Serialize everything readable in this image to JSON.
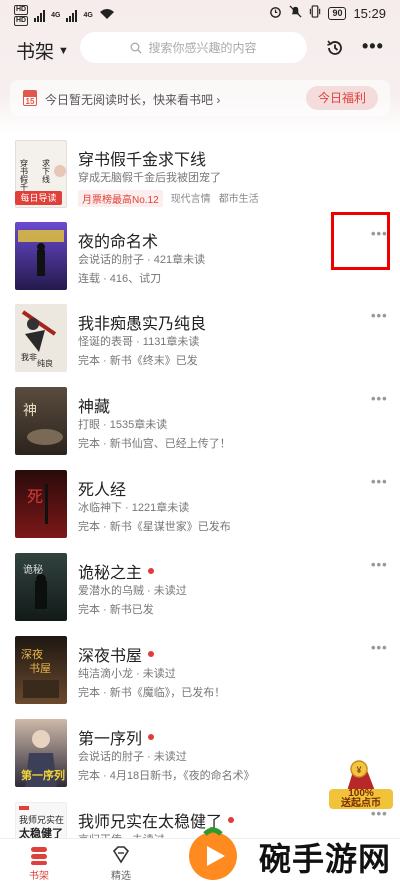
{
  "status_bar": {
    "sim1": "HD",
    "sim2": "HD",
    "net1": "4G",
    "net2": "4G",
    "battery": "90",
    "time": "15:29"
  },
  "header": {
    "title": "书架",
    "search_placeholder": "搜索你感兴趣的内容"
  },
  "banner": {
    "calendar_day": "15",
    "text": "今日暂无阅读时长，快来看书吧",
    "arrow": "›",
    "button": "今日福利"
  },
  "featured": {
    "title": "穿书假千金求下线",
    "subtitle": "穿成无脑假千金后我被团宠了",
    "badge": "每日导读",
    "tags": [
      "月票榜最高No.12",
      "现代言情",
      "都市生活"
    ],
    "cover_text": "穿书假千金求下线"
  },
  "books": [
    {
      "title": "夜的命名术",
      "line1": "会说话的肘子 · 421章未读",
      "line2": "连载 · 416、试刀",
      "dot": false,
      "cover_text": "夜的命名术",
      "cover_color": "#3a2a6e"
    },
    {
      "title": "我非痴愚实乃纯良",
      "line1": "怪诞的表哥 · 1131章未读",
      "line2": "完本 · 新书《终末》已发",
      "dot": false,
      "cover_text": "我非痴愚 实乃纯良",
      "cover_color": "#e9e4dd"
    },
    {
      "title": "神藏",
      "line1": "打眼 · 1535章未读",
      "line2": "完本 · 新书仙宫、已经上传了！",
      "dot": false,
      "cover_text": "神藏",
      "cover_color": "#4b4034"
    },
    {
      "title": "死人经",
      "line1": "冰临神下 · 1221章未读",
      "line2": "完本 · 新书《星谋世家》已发布",
      "dot": false,
      "cover_text": "死人经",
      "cover_color": "#5a1212"
    },
    {
      "title": "诡秘之主",
      "line1": "爱潜水的乌贼 · 未读过",
      "line2": "完本 · 新书已发",
      "dot": true,
      "cover_text": "诡秘之主",
      "cover_color": "#2a3a38"
    },
    {
      "title": "深夜书屋",
      "line1": "纯洁滴小龙 · 未读过",
      "line2": "完本 · 新书《魔临》，已发布！",
      "dot": true,
      "cover_text": "深夜书屋",
      "cover_color": "#3b2a1e"
    },
    {
      "title": "第一序列",
      "line1": "会说话的肘子 · 未读过",
      "line2": "完本 · 4月18日新书，《夜的命名术》",
      "dot": true,
      "cover_text": "第一序列",
      "cover_color": "#2e3d52"
    },
    {
      "title": "我师兄实在太稳健了",
      "line1": "言归正传 · 未读过",
      "line2": "",
      "dot": true,
      "cover_text": "我师兄实在 太稳健了",
      "cover_color": "#f5f5f5"
    }
  ],
  "floater": {
    "percent": "100%",
    "label": "送起点币"
  },
  "tabs": [
    {
      "label": "书架",
      "active": true
    },
    {
      "label": "精选",
      "active": false
    }
  ],
  "watermark": {
    "text": "碗手游网"
  },
  "colors": {
    "accent": "#e0403a",
    "highlight": "#ee0000"
  }
}
